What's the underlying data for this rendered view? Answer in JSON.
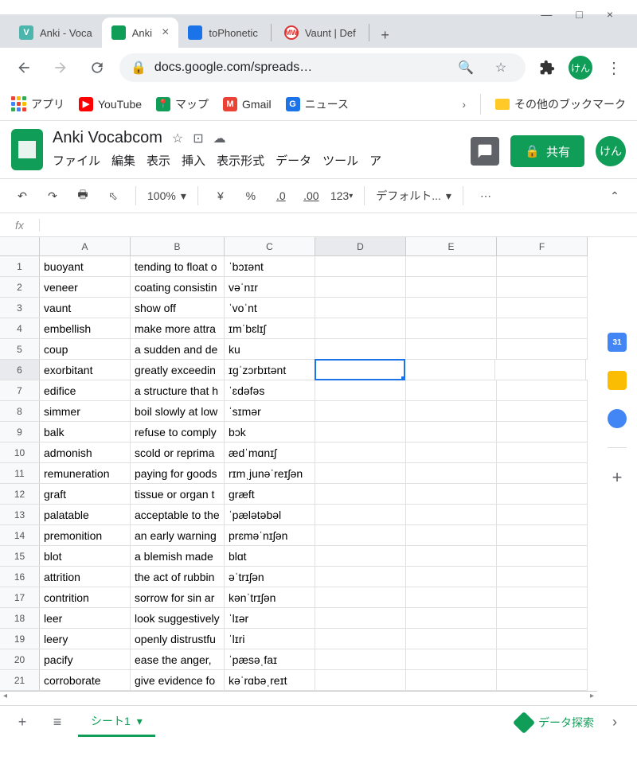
{
  "window": {
    "minimize": "—",
    "maximize": "□",
    "close": "×"
  },
  "tabs": [
    {
      "label": "Anki - Voca",
      "icon": "teal",
      "letter": "V"
    },
    {
      "label": "Anki",
      "icon": "green",
      "letter": "",
      "active": true
    },
    {
      "label": "toPhonetic",
      "icon": "blue",
      "letter": ""
    },
    {
      "label": "Vaunt | Def",
      "icon": "mw",
      "letter": "MW"
    }
  ],
  "addr": {
    "url": "docs.google.com/spreads…"
  },
  "bookmarks": {
    "apps": "アプリ",
    "items": [
      {
        "label": "YouTube",
        "color": "#f00"
      },
      {
        "label": "マップ",
        "color": "#0f9d58"
      },
      {
        "label": "Gmail",
        "color": "#ea4335"
      },
      {
        "label": "ニュース",
        "color": "#1a73e8"
      }
    ],
    "other": "その他のブックマーク"
  },
  "avatar": "けん",
  "doc": {
    "title": "Anki Vocabcom",
    "menus": [
      "ファイル",
      "編集",
      "表示",
      "挿入",
      "表示形式",
      "データ",
      "ツール",
      "ア"
    ],
    "share": "共有"
  },
  "toolbar": {
    "zoom": "100%",
    "currency": "¥",
    "percent": "%",
    "dec_dec": ".0",
    "inc_dec": ".00",
    "num_fmt": "123",
    "font": "デフォルト..."
  },
  "columns": [
    "A",
    "B",
    "C",
    "D",
    "E",
    "F"
  ],
  "selected": {
    "row": 6,
    "col": "D"
  },
  "rows": [
    {
      "n": 1,
      "a": "buoyant",
      "b": "tending to float o",
      "c": "ˈbɔɪənt"
    },
    {
      "n": 2,
      "a": "veneer",
      "b": "coating consistin",
      "c": "vəˈnɪr"
    },
    {
      "n": 3,
      "a": "vaunt",
      "b": "show off",
      "c": "ˈvoˈnt"
    },
    {
      "n": 4,
      "a": "embellish",
      "b": "make more attra",
      "c": "ɪmˈbɛlɪʃ"
    },
    {
      "n": 5,
      "a": "coup",
      "b": "a sudden and de",
      "c": "ku"
    },
    {
      "n": 6,
      "a": "exorbitant",
      "b": "greatly exceedin",
      "c": "ɪgˈzɔrbɪtənt"
    },
    {
      "n": 7,
      "a": "edifice",
      "b": "a structure that h",
      "c": "ˈɛdəfəs"
    },
    {
      "n": 8,
      "a": "simmer",
      "b": "boil slowly at low",
      "c": "ˈsɪmər"
    },
    {
      "n": 9,
      "a": "balk",
      "b": "refuse to comply",
      "c": "bɔk"
    },
    {
      "n": 10,
      "a": "admonish",
      "b": "scold or reprima",
      "c": "ædˈmɑnɪʃ"
    },
    {
      "n": 11,
      "a": "remuneration",
      "b": "paying for goods",
      "c": "rɪmˌjunəˈreɪʃən"
    },
    {
      "n": 12,
      "a": "graft",
      "b": "tissue or organ t",
      "c": "græft"
    },
    {
      "n": 13,
      "a": "palatable",
      "b": "acceptable to the",
      "c": "ˈpælətəbəl"
    },
    {
      "n": 14,
      "a": "premonition",
      "b": "an early warning",
      "c": "prɛməˈnɪʃən"
    },
    {
      "n": 15,
      "a": "blot",
      "b": "a blemish made",
      "c": "blɑt"
    },
    {
      "n": 16,
      "a": "attrition",
      "b": "the act of rubbin",
      "c": "əˈtrɪʃən"
    },
    {
      "n": 17,
      "a": "contrition",
      "b": "sorrow for sin ar",
      "c": "kənˈtrɪʃən"
    },
    {
      "n": 18,
      "a": "leer",
      "b": "look suggestively",
      "c": "ˈlɪər"
    },
    {
      "n": 19,
      "a": "leery",
      "b": "openly distrustfu",
      "c": "ˈlɪri"
    },
    {
      "n": 20,
      "a": "pacify",
      "b": "ease the anger,",
      "c": "ˈpæsəˌfaɪ"
    },
    {
      "n": 21,
      "a": "corroborate",
      "b": "give evidence fo",
      "c": "kəˈrɑbəˌreɪt"
    }
  ],
  "sheet_tab": "シート1",
  "explore": "データ探索"
}
